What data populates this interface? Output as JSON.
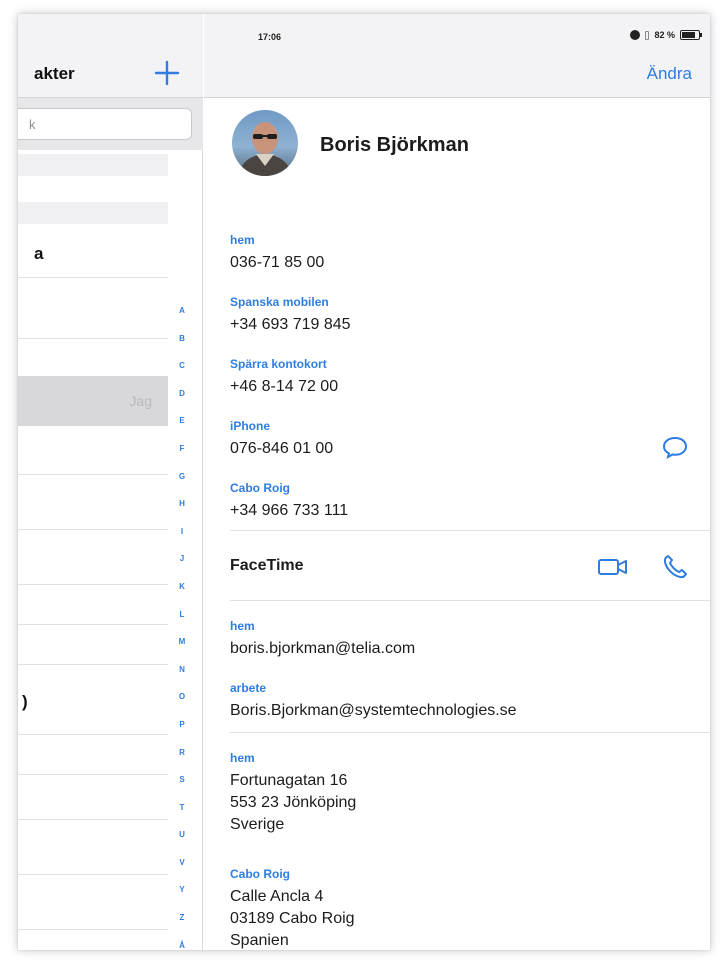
{
  "status_bar": {
    "time": "17:06",
    "battery_percent": "82 %"
  },
  "list": {
    "title": "akter",
    "search_placeholder": "k",
    "rows": [
      "a",
      "",
      "",
      ")"
    ],
    "selected_tag": "Jag",
    "index_letters": [
      "A",
      "B",
      "C",
      "D",
      "E",
      "F",
      "G",
      "H",
      "I",
      "J",
      "K",
      "L",
      "M",
      "N",
      "O",
      "P",
      "R",
      "S",
      "T",
      "U",
      "V",
      "Y",
      "Z",
      "Å"
    ]
  },
  "detail": {
    "edit_label": "Ändra",
    "name": "Boris Björkman",
    "phones": [
      {
        "label": "hem",
        "value": "036-71 85 00"
      },
      {
        "label": "Spanska mobilen",
        "value": "+34 693 719 845"
      },
      {
        "label": "Spärra kontokort",
        "value": "+46 8-14 72 00"
      },
      {
        "label": "iPhone",
        "value": "076-846 01 00"
      },
      {
        "label": "Cabo Roig",
        "value": "+34 966 733 111"
      }
    ],
    "facetime_label": "FaceTime",
    "emails": [
      {
        "label": "hem",
        "value": "boris.bjorkman@telia.com"
      },
      {
        "label": "arbete",
        "value": "Boris.Bjorkman@systemtechnologies.se"
      }
    ],
    "addresses": [
      {
        "label": "hem",
        "line1": "Fortunagatan 16",
        "line2": "553 23 Jönköping",
        "line3": "Sverige"
      },
      {
        "label": "Cabo Roig",
        "line1": "Calle Ancla 4",
        "line2": "03189 Cabo Roig",
        "line3": "Spanien"
      }
    ]
  },
  "colors": {
    "accent": "#2f7de1",
    "header_bg": "#f3f3f5",
    "selected_row": "#d8d8dc"
  }
}
